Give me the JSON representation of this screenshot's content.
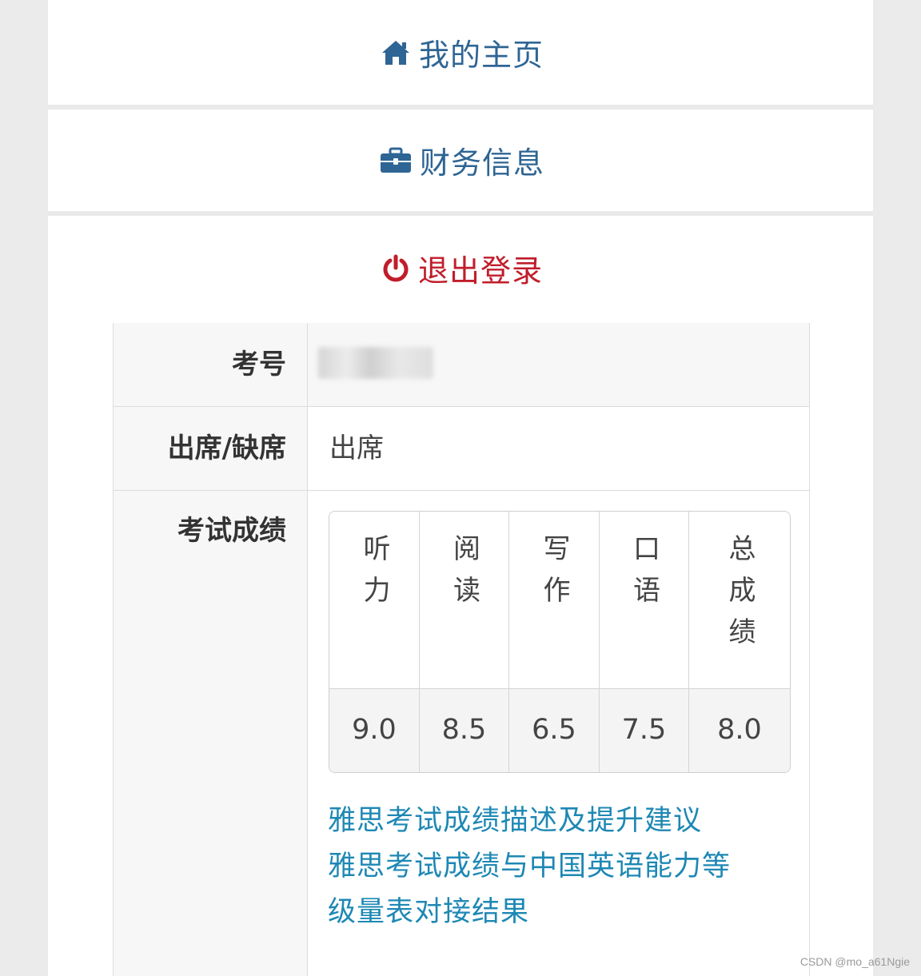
{
  "menu": {
    "home": {
      "label": "我的主页",
      "icon": "home-icon"
    },
    "finance": {
      "label": "财务信息",
      "icon": "briefcase-icon"
    },
    "logout": {
      "label": "退出登录",
      "icon": "power-icon"
    }
  },
  "colors": {
    "menu_text": "#2e6594",
    "logout_text": "#c11d2b",
    "link": "#1e88b4"
  },
  "info": {
    "exam_no": {
      "label": "考号",
      "value_state": "blurred"
    },
    "attendance": {
      "label": "出席/缺席",
      "value": "出席"
    },
    "scores": {
      "label": "考试成绩",
      "columns": [
        {
          "head": "听力",
          "value": "9.0"
        },
        {
          "head": "阅读",
          "value": "8.5"
        },
        {
          "head": "写作",
          "value": "6.5"
        },
        {
          "head": "口语",
          "value": "7.5"
        },
        {
          "head": "总成绩",
          "value": "8.0"
        }
      ]
    },
    "links": [
      "雅思考试成绩描述及提升建议",
      "雅思考试成绩与中国英语能力等",
      "级量表对接结果"
    ]
  },
  "watermark": "CSDN @mo_a61Ngie"
}
